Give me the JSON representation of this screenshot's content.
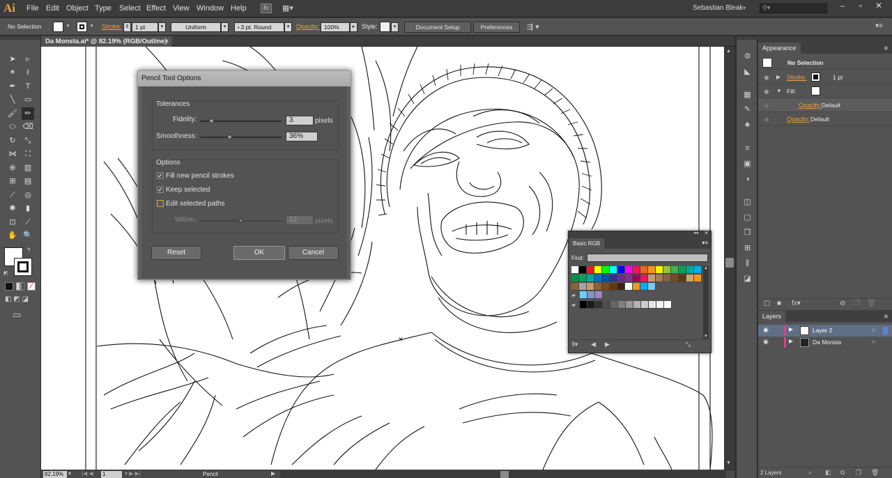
{
  "app": {
    "logo": "Ai",
    "user": "Sebastian Bleak",
    "search_placeholder": ""
  },
  "menu": [
    "File",
    "Edit",
    "Object",
    "Type",
    "Select",
    "Effect",
    "View",
    "Window",
    "Help"
  ],
  "control": {
    "selection": "No Selection",
    "stroke_label": "Stroke:",
    "stroke_value": "1 pt",
    "profile": "Uniform",
    "brush": "3 pt. Round",
    "opacity_label": "Opacity:",
    "opacity_value": "100%",
    "style_label": "Style:",
    "document_setup": "Document Setup",
    "preferences": "Preferences"
  },
  "document": {
    "tab": "Da Monsta.ai* @ 82.19% (RGB/Outline)",
    "close": "×"
  },
  "status": {
    "zoom": "82.19%",
    "page": "1",
    "tool": "Pencil"
  },
  "dialog": {
    "title": "Pencil Tool Options",
    "tolerances": "Tolerances",
    "fidelity_label": "Fidelity:",
    "fidelity_value": "3",
    "fidelity_unit": "pixels",
    "fidelity_level": 0.12,
    "smoothness_label": "Smoothness:",
    "smoothness_value": "36%",
    "smoothness_level": 0.36,
    "options": "Options",
    "fill_new": "Fill new pencil strokes",
    "keep_selected": "Keep selected",
    "edit_paths": "Edit selected paths",
    "within_label": "Within:",
    "within_value": "12",
    "within_unit": "pixels",
    "within_level": 0.5,
    "reset": "Reset",
    "ok": "OK",
    "cancel": "Cancel"
  },
  "swatches": {
    "title": "Basic RGB",
    "find_label": "Find:",
    "row1": [
      "#ffffff",
      "#000000",
      "#ed1c24",
      "#ffff00",
      "#00ff00",
      "#00ffff",
      "#0000ff",
      "#ff00ff",
      "#ed145b",
      "#f26522",
      "#f7941d",
      "#fff200",
      "#8dc63f",
      "#39b54a",
      "#00a651",
      "#00a99d",
      "#00aeef"
    ],
    "row2": [
      "#009444",
      "#00a651",
      "#00a99d",
      "#0072bc",
      "#0054a6",
      "#2e3192",
      "#662d91",
      "#92278f",
      "#9e005d",
      "#ed145b",
      "#c69c6d",
      "#a67c52",
      "#8c6239",
      "#754c24",
      "#603913",
      "#c8a96e",
      "#f7941d"
    ],
    "row3": [
      "#8c6239",
      "#a6a6a6",
      "#c69c6d",
      "#8c6239",
      "#754c24",
      "#603913",
      "#3c2415",
      "#ffffff",
      "#f7941d",
      "#00aeef",
      "#6dcff6"
    ],
    "row4": [
      "#6dcff6",
      "#8393ca",
      "#a186be"
    ],
    "row5": [
      "#000000",
      "#1a1a1a",
      "#333333",
      "#4d4d4d",
      "#666666",
      "#808080",
      "#999999",
      "#b3b3b3",
      "#cccccc",
      "#e6e6e6",
      "#f2f2f2",
      "#ffffff"
    ]
  },
  "appearance": {
    "tab": "Appearance",
    "header": "No Selection",
    "stroke_label": "Stroke:",
    "stroke_value": "1 pt",
    "fill_label": "Fill:",
    "opacity_label": "Opacity:",
    "opacity_value": "Default",
    "opacity2_label": "Opacity:",
    "opacity2_value": "Default"
  },
  "layers": {
    "tab": "Layers",
    "items": [
      {
        "name": "Layer 2",
        "color": "#e8398f"
      },
      {
        "name": "Da Monsta",
        "color": "#e8398f"
      }
    ],
    "count": "2 Layers"
  }
}
